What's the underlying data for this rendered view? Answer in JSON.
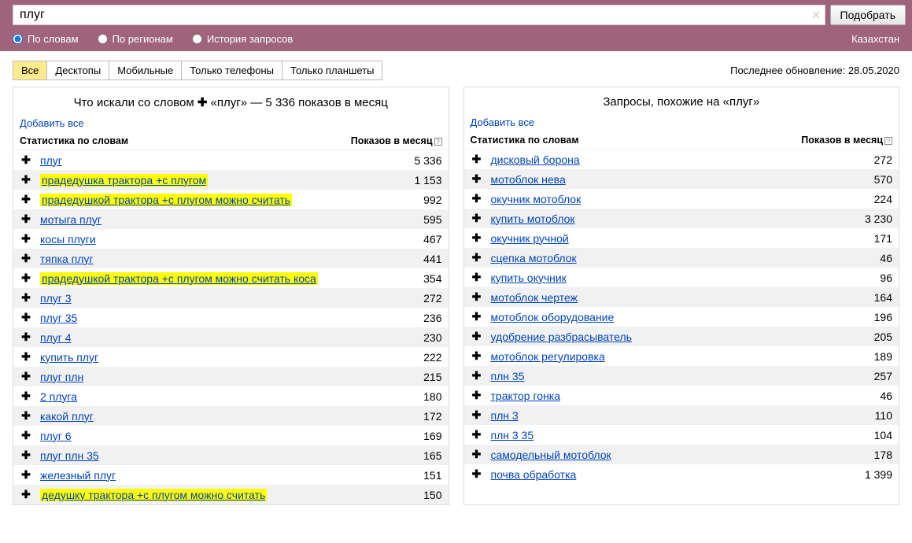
{
  "search": {
    "value": "плуг",
    "placeholder": "",
    "submit_label": "Подобрать"
  },
  "filters": {
    "by_words": "По словам",
    "by_regions": "По регионам",
    "history": "История запросов",
    "selected": "by_words",
    "region": "Казахстан"
  },
  "tabs": {
    "items": [
      "Все",
      "Десктопы",
      "Мобильные",
      "Только телефоны",
      "Только планшеты"
    ],
    "active": 0
  },
  "last_update_label": "Последнее обновление: 28.05.2020",
  "left_panel": {
    "title_prefix": "Что искали со словом",
    "title_term": "«плуг»",
    "title_suffix": "— 5 336 показов в месяц",
    "add_all": "Добавить все",
    "col_words": "Статистика по словам",
    "col_count": "Показов в месяц",
    "rows": [
      {
        "term": "плуг",
        "count": "5 336",
        "hl": false
      },
      {
        "term": "прадедушка трактора +с плугом",
        "count": "1 153",
        "hl": true
      },
      {
        "term": "прадедушкой трактора +с плугом можно считать",
        "count": "992",
        "hl": true
      },
      {
        "term": "мотыга плуг",
        "count": "595",
        "hl": false
      },
      {
        "term": "косы плуги",
        "count": "467",
        "hl": false
      },
      {
        "term": "тяпка плуг",
        "count": "441",
        "hl": false
      },
      {
        "term": "прадедушкой трактора +с плугом можно считать коса",
        "count": "354",
        "hl": true
      },
      {
        "term": "плуг 3",
        "count": "272",
        "hl": false
      },
      {
        "term": "плуг 35",
        "count": "236",
        "hl": false
      },
      {
        "term": "плуг 4",
        "count": "230",
        "hl": false
      },
      {
        "term": "купить плуг",
        "count": "222",
        "hl": false
      },
      {
        "term": "плуг плн",
        "count": "215",
        "hl": false
      },
      {
        "term": "2 плуга",
        "count": "180",
        "hl": false
      },
      {
        "term": "какой плуг",
        "count": "172",
        "hl": false
      },
      {
        "term": "плуг 6",
        "count": "169",
        "hl": false
      },
      {
        "term": "плуг плн 35",
        "count": "165",
        "hl": false
      },
      {
        "term": "железный плуг",
        "count": "151",
        "hl": false
      },
      {
        "term": "дедушку трактора +с плугом можно считать",
        "count": "150",
        "hl": true
      }
    ]
  },
  "right_panel": {
    "title": "Запросы, похожие на «плуг»",
    "add_all": "Добавить все",
    "col_words": "Статистика по словам",
    "col_count": "Показов в месяц",
    "rows": [
      {
        "term": "дисковый борона",
        "count": "272"
      },
      {
        "term": "мотоблок нева",
        "count": "570"
      },
      {
        "term": "окучник мотоблок",
        "count": "224"
      },
      {
        "term": "купить мотоблок",
        "count": "3 230"
      },
      {
        "term": "окучник ручной",
        "count": "171"
      },
      {
        "term": "сцепка мотоблок",
        "count": "46"
      },
      {
        "term": "купить окучник",
        "count": "96"
      },
      {
        "term": "мотоблок чертеж",
        "count": "164"
      },
      {
        "term": "мотоблок оборудование",
        "count": "196"
      },
      {
        "term": "удобрение разбрасыватель",
        "count": "205"
      },
      {
        "term": "мотоблок регулировка",
        "count": "189"
      },
      {
        "term": "плн 35",
        "count": "257"
      },
      {
        "term": "трактор гонка",
        "count": "46"
      },
      {
        "term": "плн 3",
        "count": "110"
      },
      {
        "term": "плн 3 35",
        "count": "104"
      },
      {
        "term": "самодельный мотоблок",
        "count": "178"
      },
      {
        "term": "почва обработка",
        "count": "1 399"
      }
    ]
  }
}
